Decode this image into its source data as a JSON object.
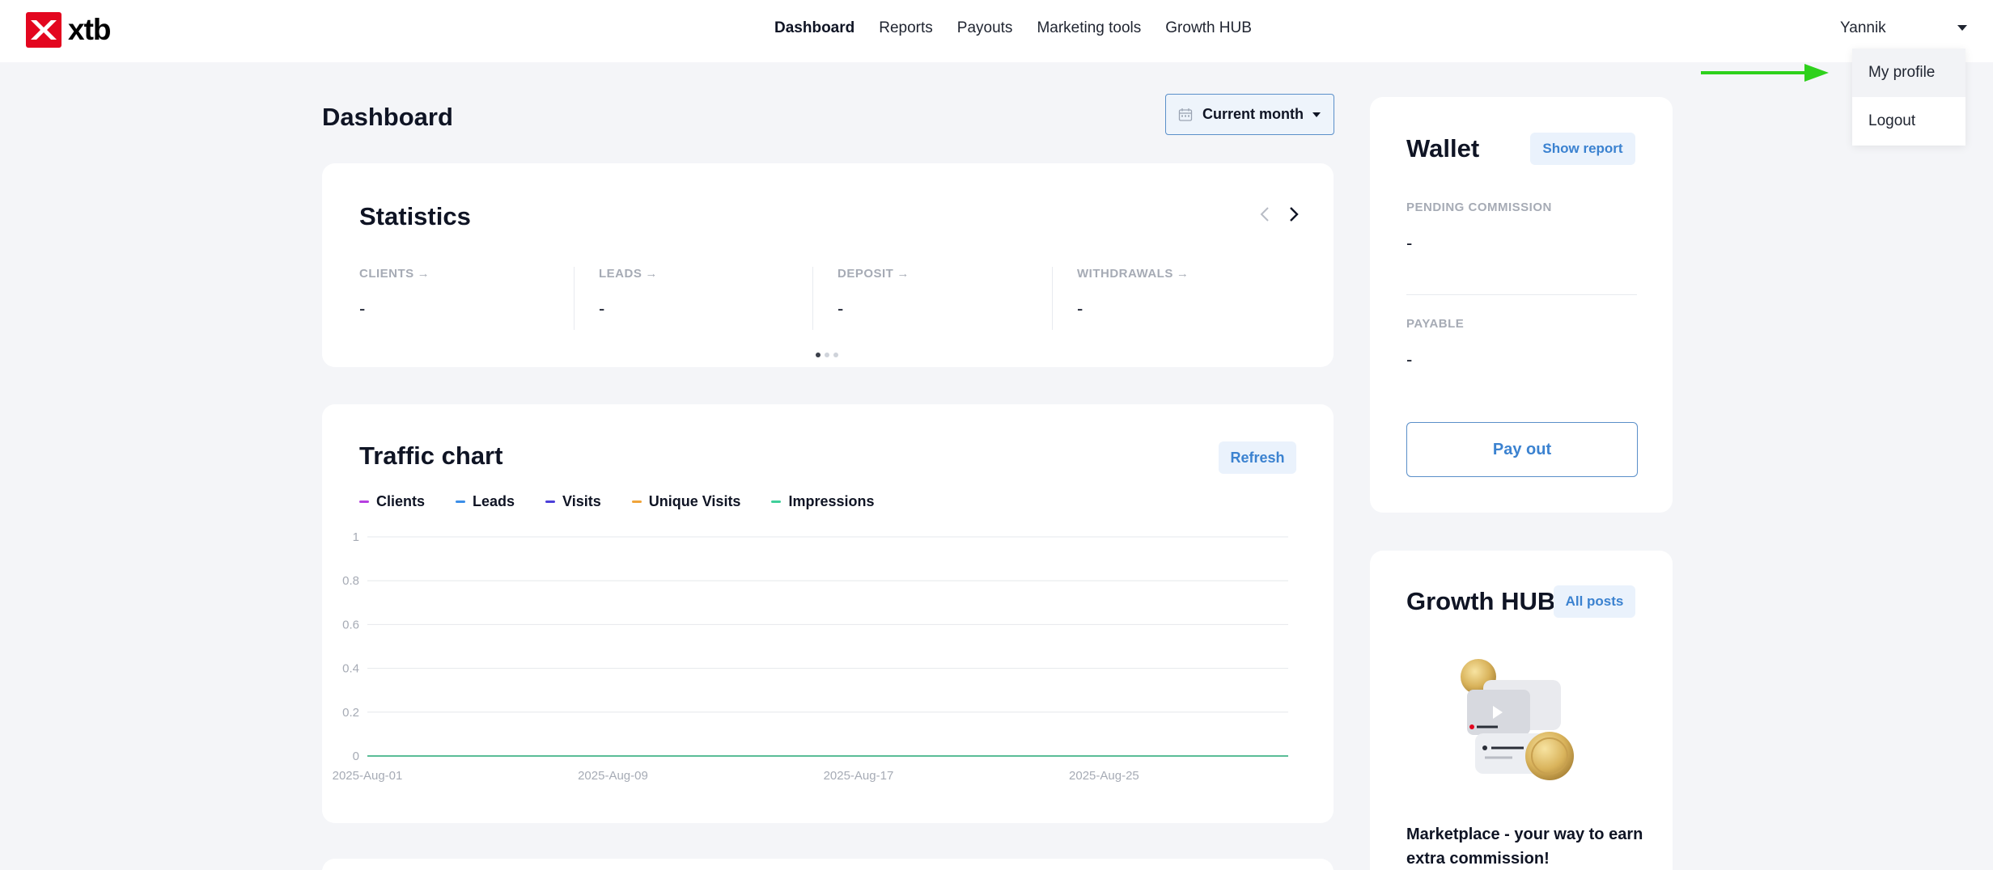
{
  "brand": {
    "name": "xtb",
    "color": "#e3061f"
  },
  "nav": {
    "items": [
      {
        "label": "Dashboard",
        "active": true
      },
      {
        "label": "Reports"
      },
      {
        "label": "Payouts"
      },
      {
        "label": "Marketing tools"
      },
      {
        "label": "Growth HUB"
      }
    ]
  },
  "user": {
    "name": "Yannik",
    "menu": [
      "My profile",
      "Logout"
    ]
  },
  "page": {
    "title": "Dashboard",
    "period": "Current month"
  },
  "statistics": {
    "title": "Statistics",
    "columns": [
      {
        "label": "CLIENTS",
        "value": "-"
      },
      {
        "label": "LEADS",
        "value": "-"
      },
      {
        "label": "DEPOSIT",
        "value": "-"
      },
      {
        "label": "WITHDRAWALS",
        "value": "-"
      }
    ],
    "page_dots": 3,
    "active_dot": 0
  },
  "traffic": {
    "title": "Traffic chart",
    "refresh_label": "Refresh"
  },
  "chart_data": {
    "type": "line",
    "series": [
      {
        "name": "Clients",
        "color": "#b63fe0"
      },
      {
        "name": "Leads",
        "color": "#3b8ee8"
      },
      {
        "name": "Visits",
        "color": "#4b3fd9"
      },
      {
        "name": "Unique Visits",
        "color": "#f0a43a"
      },
      {
        "name": "Impressions",
        "color": "#3fcf9a"
      }
    ],
    "yticks": [
      "1",
      "0.8",
      "0.6",
      "0.4",
      "0.2",
      "0"
    ],
    "ylim": [
      0,
      1
    ],
    "xticks": [
      "2025-Aug-01",
      "2025-Aug-09",
      "2025-Aug-17",
      "2025-Aug-25"
    ],
    "xlim": [
      "2025-Aug-01",
      "2025-Aug-31"
    ],
    "all_values_zero": true,
    "grid": true
  },
  "wallet": {
    "title": "Wallet",
    "show_report_label": "Show report",
    "pending_label": "PENDING COMMISSION",
    "pending_value": "-",
    "payable_label": "PAYABLE",
    "payable_value": "-",
    "payout_label": "Pay out"
  },
  "growth": {
    "title": "Growth HUB",
    "all_posts_label": "All posts",
    "post_title": "Marketplace - your way to earn extra commission!"
  }
}
